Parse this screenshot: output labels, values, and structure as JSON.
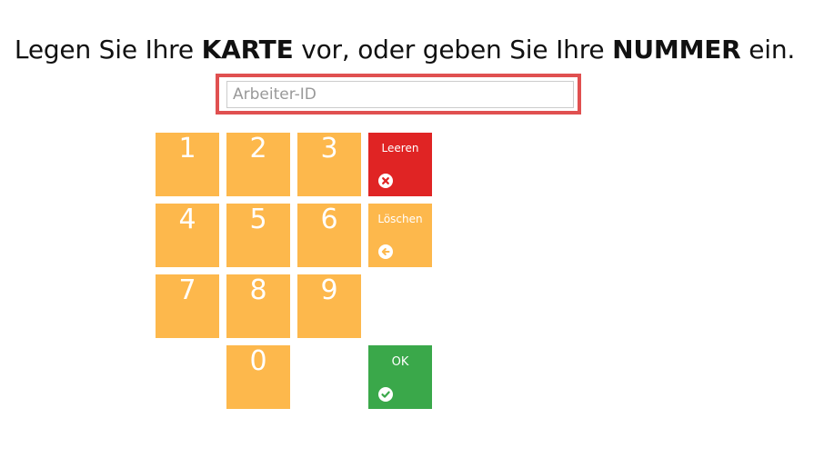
{
  "headline": {
    "part1": "Legen Sie Ihre ",
    "bold1": "KARTE",
    "part2": " vor, oder geben Sie Ihre ",
    "bold2": "NUMMER",
    "part3": " ein."
  },
  "input": {
    "placeholder": "Arbeiter-ID",
    "value": ""
  },
  "keypad": {
    "digits": [
      "1",
      "2",
      "3",
      "4",
      "5",
      "6",
      "7",
      "8",
      "9",
      "0"
    ],
    "clear_label": "Leeren",
    "delete_label": "Löschen",
    "ok_label": "OK"
  },
  "colors": {
    "digit_key": "#fdb84c",
    "clear_key": "#e02424",
    "delete_key": "#fdb84c",
    "ok_key": "#3aa84a",
    "input_highlight": "#e05050"
  },
  "icons": {
    "clear": "times-circle-icon",
    "delete": "arrow-left-circle-icon",
    "ok": "check-circle-icon"
  }
}
